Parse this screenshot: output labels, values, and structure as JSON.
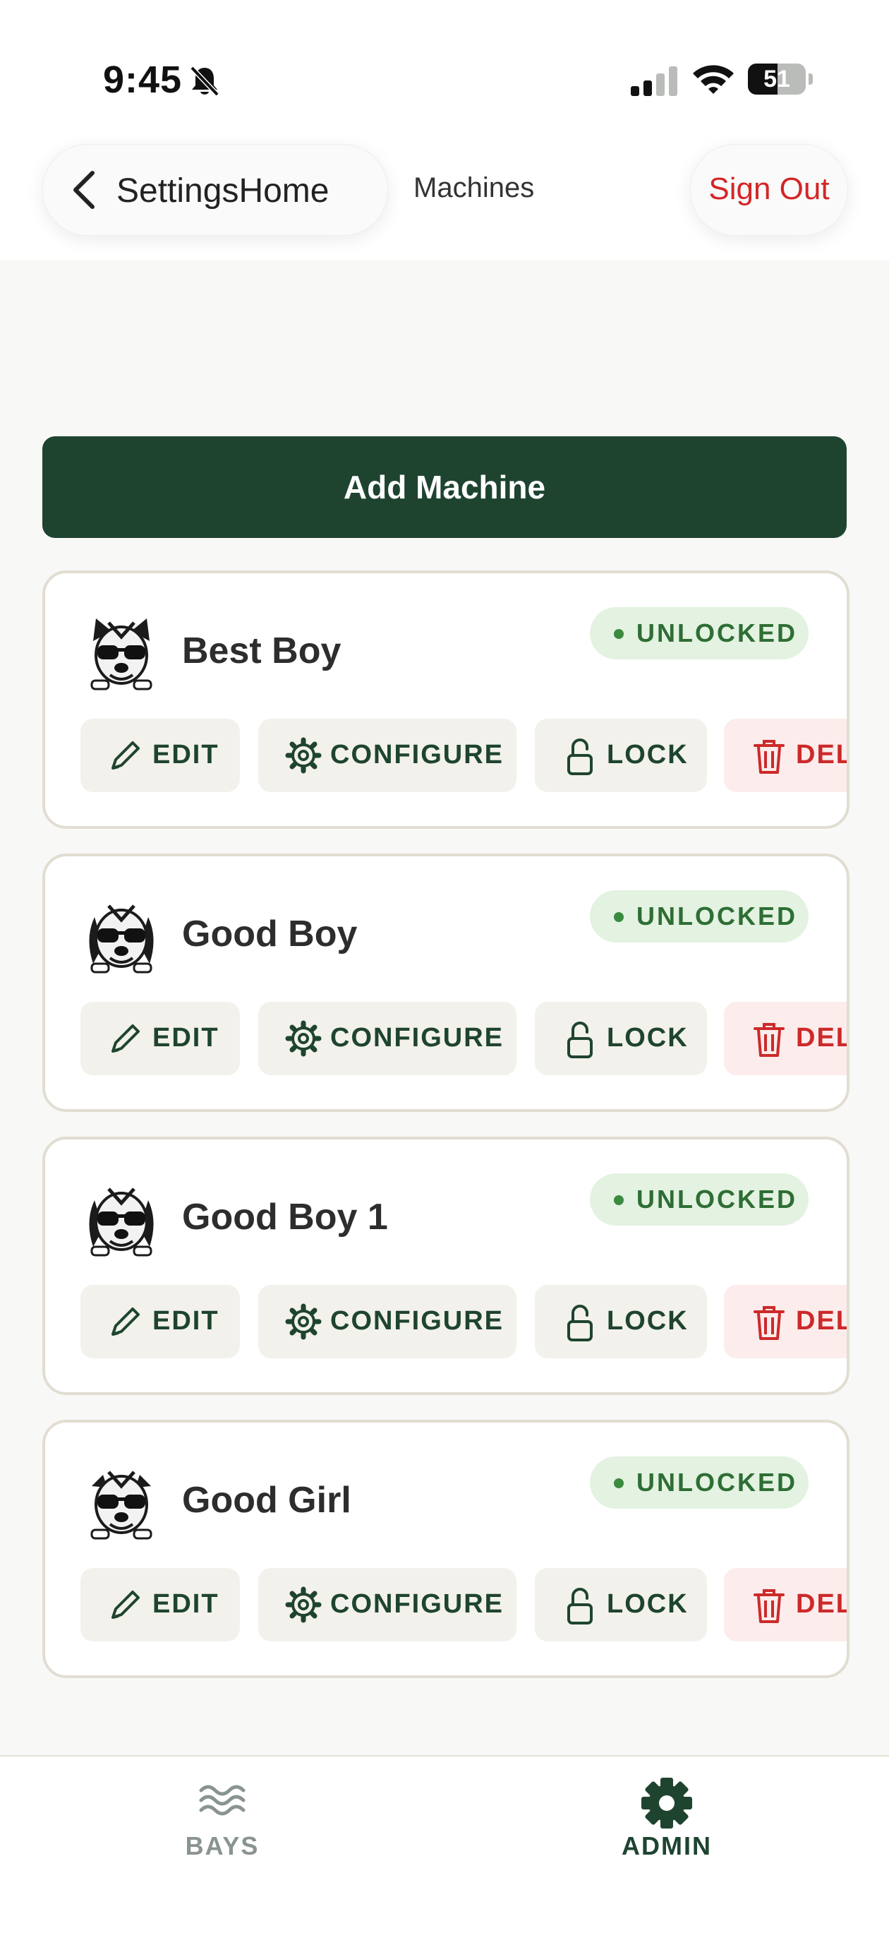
{
  "status_bar": {
    "time": "9:45",
    "battery": "51",
    "battery_level": 0.51
  },
  "header": {
    "back_label": "SettingsHome",
    "title": "Machines",
    "sign_out": "Sign Out"
  },
  "add_machine_label": "Add Machine",
  "actions": {
    "edit": "EDIT",
    "configure": "CONFIGURE",
    "lock": "LOCK",
    "delete": "DEL"
  },
  "machines": [
    {
      "name": "Best Boy",
      "status": "UNLOCKED",
      "avatar": "bulldog-sunglasses-icon"
    },
    {
      "name": "Good Boy",
      "status": "UNLOCKED",
      "avatar": "longhair-dog-sunglasses-icon"
    },
    {
      "name": "Good Boy 1",
      "status": "UNLOCKED",
      "avatar": "longhair-dog-sunglasses-icon"
    },
    {
      "name": "Good Girl",
      "status": "UNLOCKED",
      "avatar": "pitbull-sunglasses-icon"
    }
  ],
  "tabs": [
    {
      "label": "BAYS",
      "icon": "waves-icon",
      "active": false
    },
    {
      "label": "ADMIN",
      "icon": "gear-icon",
      "active": true
    }
  ],
  "colors": {
    "accent": "#1e4430",
    "danger": "#d32626",
    "status_bg": "#e3f2e1",
    "status_text": "#2e6e34",
    "card_border": "#e2ddd2"
  }
}
